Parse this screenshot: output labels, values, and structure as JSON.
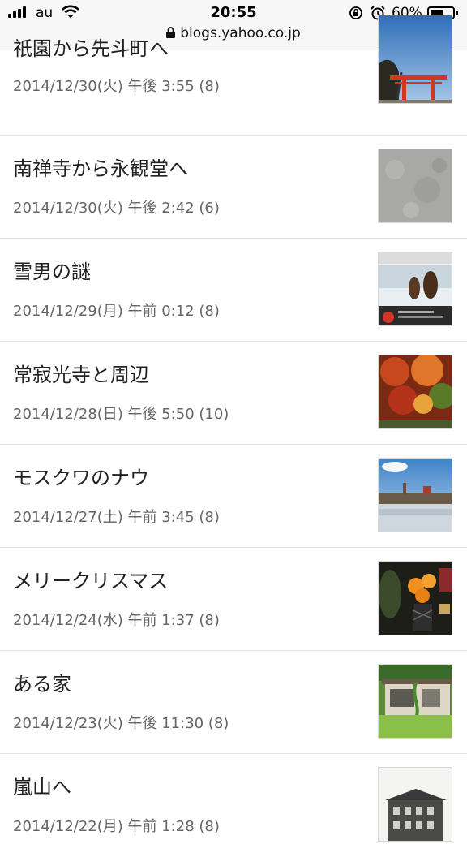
{
  "status_bar": {
    "carrier": "au",
    "time": "20:55",
    "battery_percent": "60%",
    "battery_level": 0.6,
    "url": "blogs.yahoo.co.jp"
  },
  "posts": [
    {
      "title": "祇園から先斗町へ",
      "meta": "2014/12/30(火) 午後 3:55 (8)",
      "thumb": "torii-gate-photo"
    },
    {
      "title": "南禅寺から永観堂へ",
      "meta": "2014/12/30(火) 午後 2:42 (6)",
      "thumb": "stone-texture-photo"
    },
    {
      "title": "雪男の謎",
      "meta": "2014/12/29(月) 午前 0:12 (8)",
      "thumb": "yeti-screenshot-photo"
    },
    {
      "title": "常寂光寺と周辺",
      "meta": "2014/12/28(日) 午後 5:50 (10)",
      "thumb": "autumn-leaves-photo"
    },
    {
      "title": "モスクワのナウ",
      "meta": "2014/12/27(土) 午前 3:45 (8)",
      "thumb": "moscow-river-photo"
    },
    {
      "title": "メリークリスマス",
      "meta": "2014/12/24(水) 午前 1:37 (8)",
      "thumb": "flowers-vase-photo"
    },
    {
      "title": "ある家",
      "meta": "2014/12/23(火) 午後 11:30 (8)",
      "thumb": "house-garden-photo"
    },
    {
      "title": "嵐山へ",
      "meta": "2014/12/22(月) 午前 1:28 (8)",
      "thumb": "old-building-photo"
    }
  ]
}
